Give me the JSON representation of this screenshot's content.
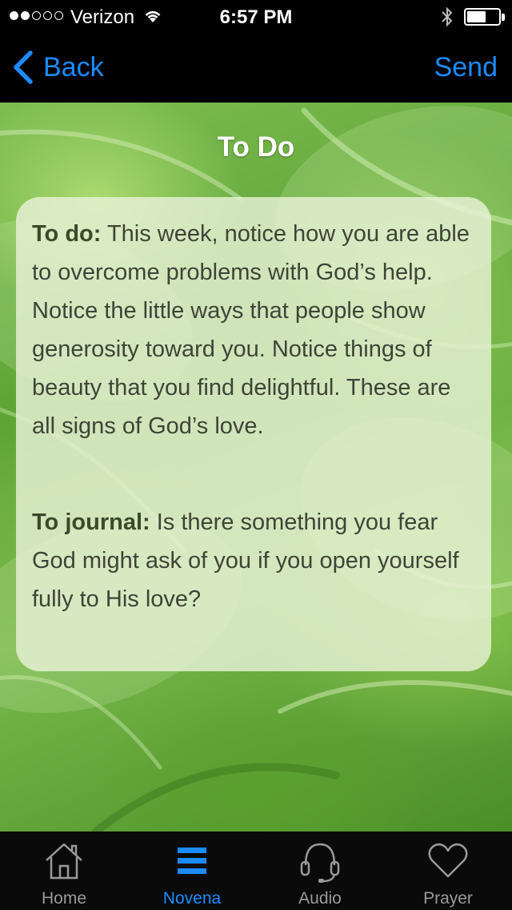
{
  "status_bar": {
    "carrier": "Verizon",
    "time": "6:57 PM",
    "signal_bars_filled": 2,
    "signal_bars_total": 5,
    "battery_level": 0.55,
    "icons": [
      "wifi-icon",
      "bluetooth-icon",
      "battery-icon"
    ]
  },
  "nav": {
    "back_label": "Back",
    "send_label": "Send",
    "accent": "#1a8cff"
  },
  "page": {
    "title": "To Do"
  },
  "card": {
    "todo_lead": "To do:",
    "todo_text": " This week, notice how you are able to overcome problems with God’s help. Notice the little ways that people show generosity toward you. Notice things of beauty that you find delightful. These are all signs of God’s love.",
    "journal_lead": "To journal:",
    "journal_text": " Is there something you fear God might ask of you if you open yourself fully to His love?"
  },
  "tabs": [
    {
      "label": "Home",
      "icon": "home-icon",
      "active": false
    },
    {
      "label": "Novena",
      "icon": "list-icon",
      "active": true
    },
    {
      "label": "Audio",
      "icon": "headphones-icon",
      "active": false
    },
    {
      "label": "Prayer",
      "icon": "heart-icon",
      "active": false
    }
  ]
}
